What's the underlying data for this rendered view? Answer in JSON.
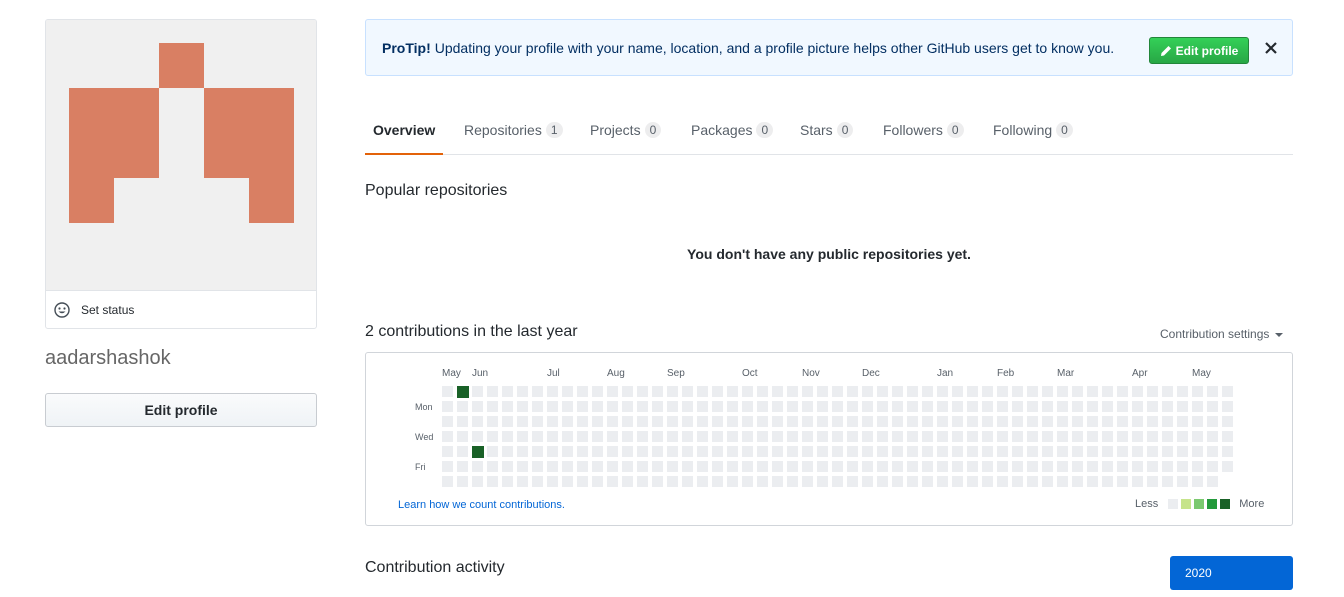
{
  "profile": {
    "username": "aadarshashok",
    "set_status_label": "Set status",
    "edit_profile_label": "Edit profile"
  },
  "protip": {
    "bold": "ProTip!",
    "text": "Updating your profile with your name, location, and a profile picture helps other GitHub users get to know you.",
    "button_label": "Edit profile"
  },
  "tabs": [
    {
      "label": "Overview",
      "count": null,
      "active": true
    },
    {
      "label": "Repositories",
      "count": "1"
    },
    {
      "label": "Projects",
      "count": "0"
    },
    {
      "label": "Packages",
      "count": "0"
    },
    {
      "label": "Stars",
      "count": "0"
    },
    {
      "label": "Followers",
      "count": "0"
    },
    {
      "label": "Following",
      "count": "0"
    }
  ],
  "popular": {
    "title": "Popular repositories",
    "empty_message": "You don't have any public repositories yet."
  },
  "contributions": {
    "title": "2 contributions in the last year",
    "settings_label": "Contribution settings",
    "months": [
      "May",
      "Jun",
      "Jul",
      "Aug",
      "Sep",
      "Oct",
      "Nov",
      "Dec",
      "Jan",
      "Feb",
      "Mar",
      "Apr",
      "May"
    ],
    "day_labels": [
      "Mon",
      "Wed",
      "Fri"
    ],
    "learn_link": "Learn how we count contributions.",
    "legend_less": "Less",
    "legend_more": "More",
    "colors": {
      "empty": "#ebedf0",
      "level1": "#c6e48b",
      "level2": "#7bc96f",
      "level3": "#239a3b",
      "level4": "#196127"
    },
    "active_days": [
      {
        "week": 1,
        "day": 0,
        "level": 4
      },
      {
        "week": 2,
        "day": 4,
        "level": 4
      }
    ]
  },
  "activity": {
    "title": "Contribution activity",
    "year_label": "2020"
  },
  "colors": {
    "avatar": "#d97f63",
    "avatar_bg": "#f0f0f0",
    "accent_orange": "#e36209",
    "primary_blue": "#0366d6",
    "green": "#28a745"
  }
}
